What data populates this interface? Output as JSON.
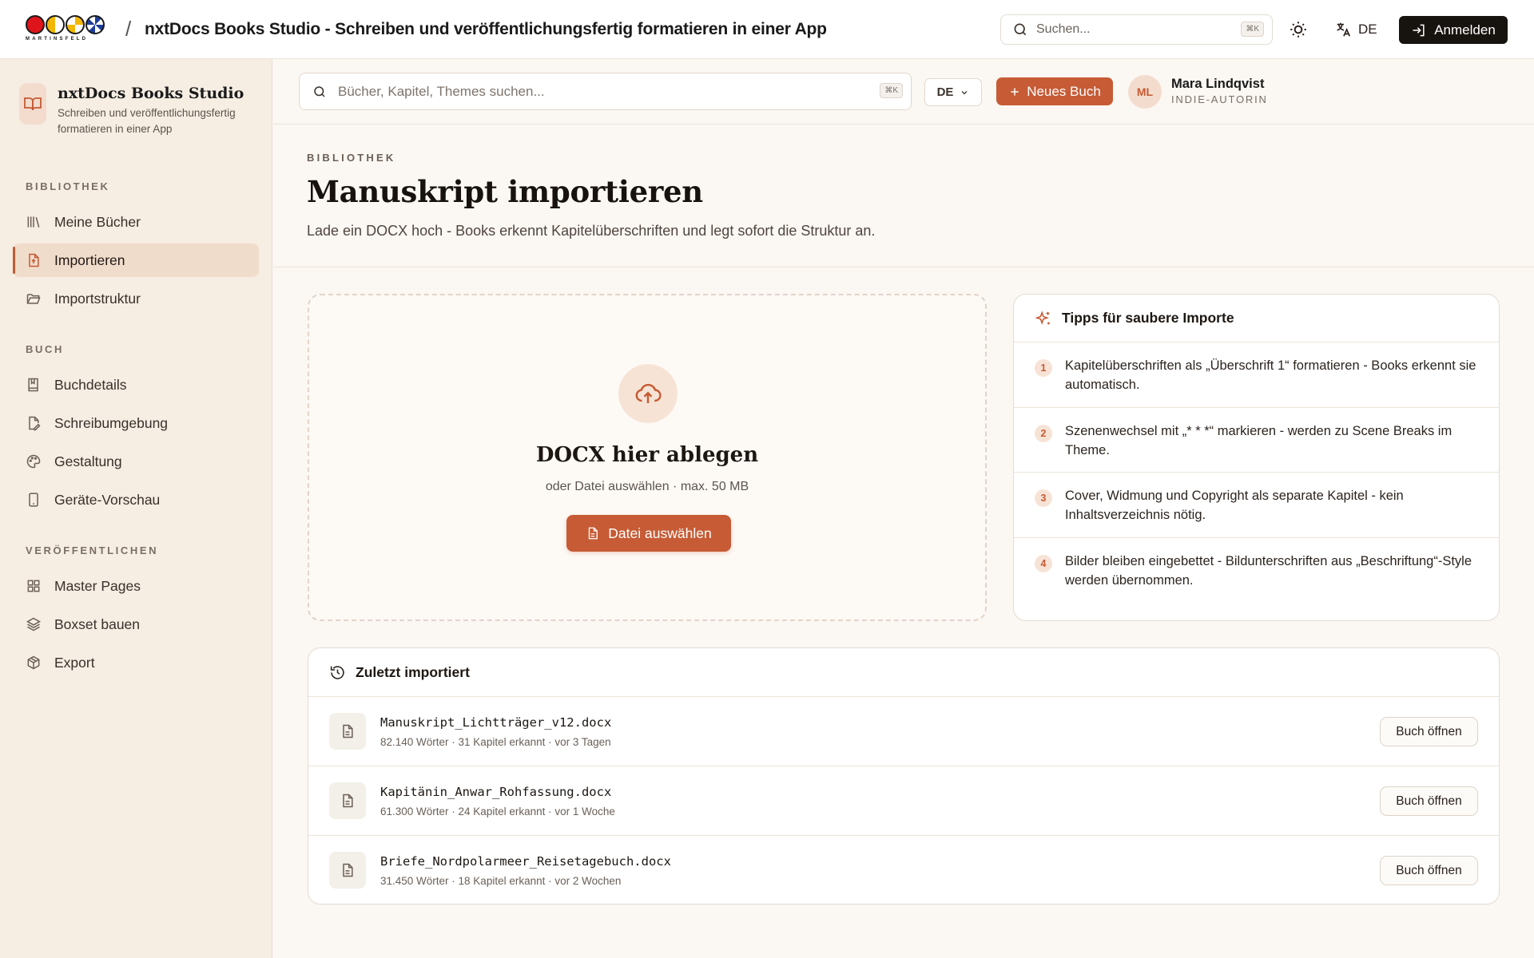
{
  "topbar": {
    "logo_text": "MARTINSFELD",
    "separator": "/",
    "app_title": "nxtDocs Books Studio - Schreiben und veröffentlichungsfertig formatieren in einer App",
    "search_placeholder": "Suchen...",
    "search_shortcut": "⌘K",
    "language": "DE",
    "login_label": "Anmelden"
  },
  "sidebar": {
    "brand_name": "nxtDocs Books Studio",
    "brand_subtitle": "Schreiben und veröffentlichungsfertig formatieren in einer App",
    "sections": [
      {
        "title": "BIBLIOTHEK",
        "items": [
          {
            "label": "Meine Bücher",
            "icon": "library-icon"
          },
          {
            "label": "Importieren",
            "icon": "file-import-icon",
            "active": true
          },
          {
            "label": "Importstruktur",
            "icon": "folder-open-icon"
          }
        ]
      },
      {
        "title": "BUCH",
        "items": [
          {
            "label": "Buchdetails",
            "icon": "book-icon"
          },
          {
            "label": "Schreibumgebung",
            "icon": "file-pen-icon"
          },
          {
            "label": "Gestaltung",
            "icon": "palette-icon"
          },
          {
            "label": "Geräte-Vorschau",
            "icon": "smartphone-icon"
          }
        ]
      },
      {
        "title": "VERÖFFENTLICHEN",
        "items": [
          {
            "label": "Master Pages",
            "icon": "grid-icon"
          },
          {
            "label": "Boxset bauen",
            "icon": "layers-icon"
          },
          {
            "label": "Export",
            "icon": "package-icon"
          }
        ]
      }
    ]
  },
  "content_bar": {
    "search_placeholder": "Bücher, Kapitel, Themes suchen...",
    "search_shortcut": "⌘K",
    "language": "DE",
    "new_book_label": "Neues Buch",
    "user_initials": "ML",
    "user_name": "Mara Lindqvist",
    "user_role": "INDIE-AUTORIN"
  },
  "page": {
    "eyebrow": "BIBLIOTHEK",
    "title": "Manuskript importieren",
    "description": "Lade ein DOCX hoch - Books erkennt Kapitelüberschriften und legt sofort die Struktur an."
  },
  "dropzone": {
    "title": "DOCX hier ablegen",
    "subtitle": "oder Datei auswählen · max. 50 MB",
    "button_label": "Datei auswählen"
  },
  "tips": {
    "title": "Tipps für saubere Importe",
    "items": [
      {
        "num": "1",
        "text": "Kapitelüberschriften als „Überschrift 1“ formatieren - Books erkennt sie automatisch."
      },
      {
        "num": "2",
        "text": "Szenenwechsel mit „* * *“ markieren - werden zu Scene Breaks im Theme."
      },
      {
        "num": "3",
        "text": "Cover, Widmung und Copyright als separate Kapitel - kein Inhaltsverzeichnis nötig."
      },
      {
        "num": "4",
        "text": "Bilder bleiben eingebettet - Bildunterschriften aus „Beschriftung“-Style werden übernommen."
      }
    ]
  },
  "recent": {
    "title": "Zuletzt importiert",
    "open_label": "Buch öffnen",
    "items": [
      {
        "file": "Manuskript_Lichtträger_v12.docx",
        "meta": "82.140 Wörter · 31 Kapitel erkannt · vor 3 Tagen"
      },
      {
        "file": "Kapitänin_Anwar_Rohfassung.docx",
        "meta": "61.300 Wörter · 24 Kapitel erkannt · vor 1 Woche"
      },
      {
        "file": "Briefe_Nordpolarmeer_Reisetagebuch.docx",
        "meta": "31.450 Wörter · 18 Kapitel erkannt · vor 2 Wochen"
      }
    ]
  },
  "colors": {
    "accent": "#c65b35",
    "accent_soft": "#f7e3d6",
    "sidebar_bg": "#f6ede3",
    "page_bg": "#fbf7f2",
    "dark_button": "#17130f"
  }
}
